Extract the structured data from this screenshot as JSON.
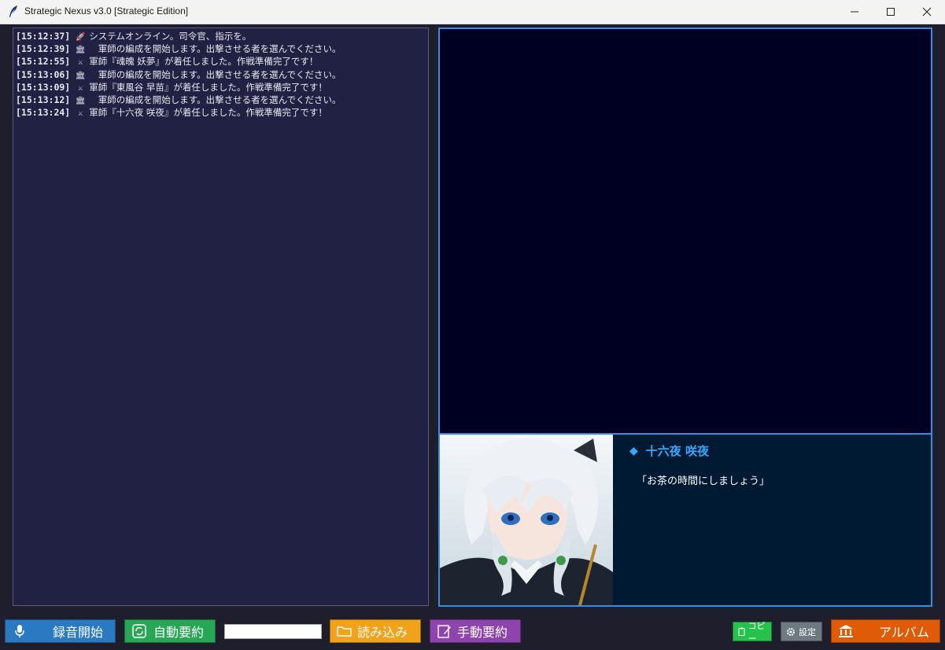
{
  "window": {
    "title": "Strategic Nexus v3.0 [Strategic Edition]",
    "controls": [
      "minimize-icon",
      "maximize-icon",
      "close-icon"
    ]
  },
  "log": {
    "entries": [
      {
        "time": "[15:12:37]",
        "icon": "rocket-icon",
        "message": "システムオンライン。司令官、指示を。"
      },
      {
        "time": "[15:12:39]",
        "icon": "bank-icon",
        "message": "　軍師の編成を開始します。出撃させる者を選んでください。"
      },
      {
        "time": "[15:12:55]",
        "icon": "crossed-swords-icon",
        "message": "軍師『魂魄 妖夢』が着任しました。作戦準備完了です！"
      },
      {
        "time": "[15:13:06]",
        "icon": "bank-icon",
        "message": "　軍師の編成を開始します。出撃させる者を選んでください。"
      },
      {
        "time": "[15:13:09]",
        "icon": "crossed-swords-icon",
        "message": "軍師『東風谷 早苗』が着任しました。作戦準備完了です！"
      },
      {
        "time": "[15:13:12]",
        "icon": "bank-icon",
        "message": "　軍師の編成を開始します。出撃させる者を選んでください。"
      },
      {
        "time": "[15:13:24]",
        "icon": "crossed-swords-icon",
        "message": "軍師『十六夜 咲夜』が着任しました。作戦準備完了です！"
      }
    ]
  },
  "dialog": {
    "speaker": "十六夜 咲夜",
    "speaker_marker": "◆",
    "quote": "「お茶の時間にしましょう」",
    "portrait": "character-portrait"
  },
  "toolbar": {
    "record_label": "録音開始",
    "auto_summary_label": "自動要約",
    "input_value": "",
    "load_label": "読み込み",
    "manual_summary_label": "手動要約",
    "copy_label": "コピー",
    "settings_label": "設定",
    "album_label": "アルバム"
  },
  "colors": {
    "background": "#1e1e2c",
    "log_bg": "#212143",
    "display_bg": "#000022",
    "dialog_bg": "#001a33",
    "accent_border": "#3a8ee0",
    "speaker": "#35a8ff",
    "record": "#2b79c0",
    "auto_summary": "#27a755",
    "load": "#f0a21a",
    "manual_summary": "#8e44ad",
    "copy": "#27c24c",
    "settings": "#6f7a80",
    "album": "#e05b06"
  }
}
